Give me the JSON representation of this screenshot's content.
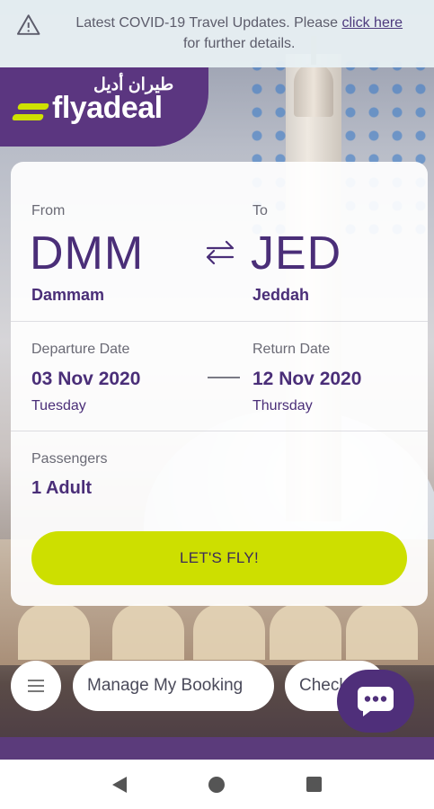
{
  "banner": {
    "text": "Latest COVID-19 Travel Updates. Please ",
    "link": "click here",
    "text2": "for further details."
  },
  "logo": {
    "arabic": "طيران أديل",
    "name": "flyadeal"
  },
  "from": {
    "label": "From",
    "code": "DMM",
    "city": "Dammam"
  },
  "to": {
    "label": "To",
    "code": "JED",
    "city": "Jeddah"
  },
  "departure": {
    "label": "Departure Date",
    "date": "03 Nov 2020",
    "day": "Tuesday"
  },
  "return": {
    "label": "Return Date",
    "date": "12 Nov 2020",
    "day": "Thursday"
  },
  "passengers": {
    "label": "Passengers",
    "value": "1 Adult"
  },
  "cta": {
    "label": "LET'S FLY!"
  },
  "bottom_nav": {
    "manage": "Manage My Booking",
    "checkin": "Check-in"
  },
  "colors": {
    "brand_purple": "#5b3680",
    "accent_lime": "#cddf00"
  }
}
